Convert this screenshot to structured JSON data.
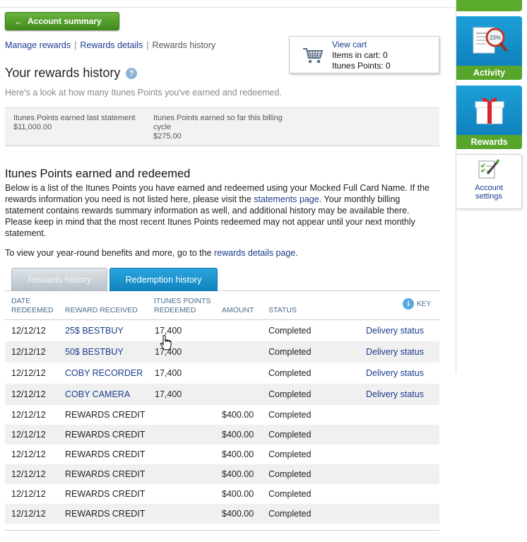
{
  "nav": {
    "back_label": "Account summary",
    "breadcrumbs": [
      "Manage rewards",
      "Rewards details",
      "Rewards history"
    ]
  },
  "cart": {
    "title": "View cart",
    "items_line": "Items in cart: 0",
    "points_line": "Itunes Points: 0"
  },
  "page": {
    "title": "Your rewards history",
    "help_glyph": "?",
    "intro": "Here's a look at how many Itunes Points you've earned and redeemed."
  },
  "summary": {
    "earned_last_label": "Itunes Points earned last statement",
    "earned_last_value": "$11,000.00",
    "earned_cycle_label": "Itunes Points earned so far this billing cycle",
    "earned_cycle_value": "$275.00"
  },
  "section": {
    "title": "Itunes Points earned and redeemed",
    "desc_part1": "Below is a list of the Itunes Points you have earned and redeemed using your Mocked Full Card Name. If the rewards information you need is not listed here, please visit the ",
    "desc_link": "statements page",
    "desc_part2": ". Your monthly billing statement contains rewards summary information as well, and additional history may be available there. Please keep in mind that the most recent Itunes Points redeemed may not appear until your next monthly statement.",
    "benefits_part1": "To view your year-round benefits and more, go to the ",
    "benefits_link": "rewards details page",
    "benefits_part2": "."
  },
  "tabs": {
    "rewards_history": "Rewards history",
    "redemption_history": "Redemption history"
  },
  "table": {
    "headers": {
      "date_1": "DATE",
      "date_2": "REDEEMED",
      "reward": "REWARD RECEIVED",
      "points_1": "ITUNES POINTS",
      "points_2": "REDEEMED",
      "amount": "AMOUNT",
      "status": "STATUS",
      "key": "KEY",
      "key_glyph": "i"
    },
    "rows": [
      {
        "date": "12/12/12",
        "reward": "25$ BESTBUY",
        "points": "17,400",
        "amount": "",
        "status": "Completed",
        "action": "Delivery status"
      },
      {
        "date": "12/12/12",
        "reward": "50$ BESTBUY",
        "points": "17,400",
        "amount": "",
        "status": "Completed",
        "action": "Delivery status"
      },
      {
        "date": "12/12/12",
        "reward": "COBY RECORDER",
        "points": "17,400",
        "amount": "",
        "status": "Completed",
        "action": "Delivery status"
      },
      {
        "date": "12/12/12",
        "reward": "COBY CAMERA",
        "points": "17,400",
        "amount": "",
        "status": "Completed",
        "action": "Delivery status"
      },
      {
        "date": "12/12/12",
        "reward": "REWARDS CREDIT",
        "points": "",
        "amount": "$400.00",
        "status": "Completed",
        "action": ""
      },
      {
        "date": "12/12/12",
        "reward": "REWARDS CREDIT",
        "points": "",
        "amount": "$400.00",
        "status": "Completed",
        "action": ""
      },
      {
        "date": "12/12/12",
        "reward": "REWARDS CREDIT",
        "points": "",
        "amount": "$400.00",
        "status": "Completed",
        "action": ""
      },
      {
        "date": "12/12/12",
        "reward": "REWARDS CREDIT",
        "points": "",
        "amount": "$400.00",
        "status": "Completed",
        "action": ""
      },
      {
        "date": "12/12/12",
        "reward": "REWARDS CREDIT",
        "points": "",
        "amount": "$400.00",
        "status": "Completed",
        "action": ""
      },
      {
        "date": "12/12/12",
        "reward": "REWARDS CREDIT",
        "points": "",
        "amount": "$400.00",
        "status": "Completed",
        "action": ""
      }
    ]
  },
  "sidebar": {
    "activity_label": "Activity",
    "rewards_label": "Rewards",
    "settings_label_1": "Account",
    "settings_label_2": "settings",
    "activity_icon_text": "BALANCE 23%"
  },
  "icons": {
    "back": "arrow-left-icon",
    "cart": "shopping-cart-icon",
    "help": "question-mark-icon",
    "key_info": "info-icon",
    "activity": "magnifier-statement-icon",
    "rewards": "gift-icon",
    "settings": "checklist-pencil-icon",
    "cursor": "hand-pointer-icon"
  },
  "colors": {
    "brand_green": "#5aaa2b",
    "brand_blue": "#1492cf",
    "link": "#1a3c8c",
    "header_text": "#4a6b8a",
    "row_alt": "#f0f0f0"
  }
}
